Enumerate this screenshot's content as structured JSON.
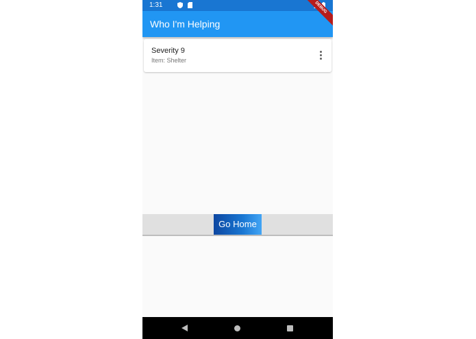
{
  "status_bar": {
    "time": "1:31",
    "icons": [
      "shield-icon",
      "sd-card-icon",
      "signal-icon",
      "battery-icon"
    ]
  },
  "debug_banner": "DEBUG",
  "app_bar": {
    "title": "Who I'm Helping"
  },
  "requests": [
    {
      "title": "Severity 9",
      "subtitle": "Item: Shelter",
      "menu_icon": "more-vert-icon"
    }
  ],
  "bottom_bar": {
    "go_home_label": "Go Home"
  },
  "nav_bar": {
    "icons": [
      "back-icon",
      "home-icon",
      "recents-icon"
    ]
  },
  "colors": {
    "status_bar": "#1976d2",
    "app_bar": "#2196f3",
    "background": "#fafafa",
    "button_start": "#0d47a1",
    "button_end": "#42a5f5"
  }
}
